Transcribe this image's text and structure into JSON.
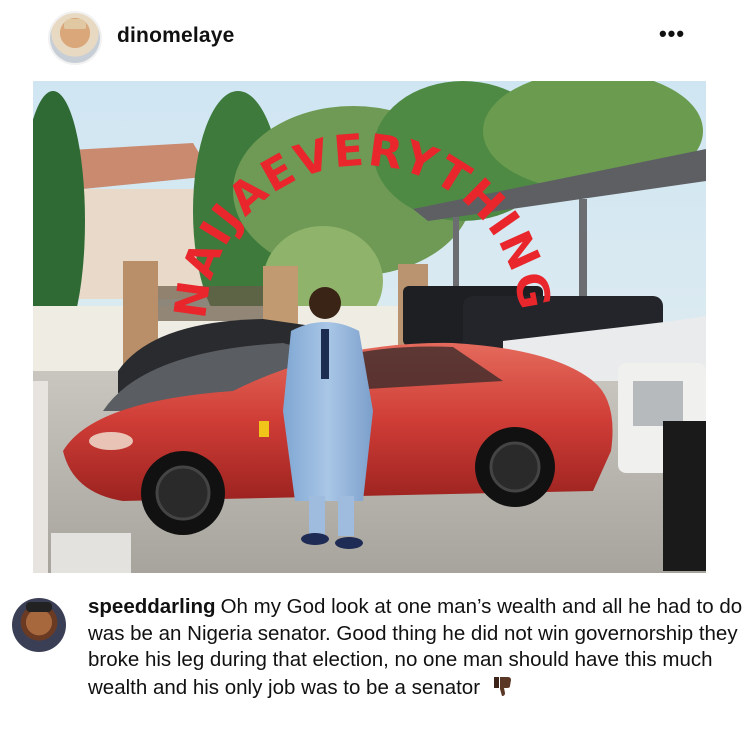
{
  "post": {
    "username": "dinomelaye",
    "more_label": "•••",
    "watermark": "NAIJAEVERYTHING",
    "car_badge": "♞",
    "avatar_icon": "profile-avatar",
    "colors": {
      "watermark": "#e8262b",
      "car": "#d23a3a"
    }
  },
  "comment": {
    "username": "speeddarling",
    "text": "Oh my God look at one man’s wealth and all he had to do was be an Nigeria senator. Good thing he did not win governorship they broke his leg during that election, no one man should have this much wealth and his only job was to be a senator",
    "emoji": "thumbs-down"
  }
}
